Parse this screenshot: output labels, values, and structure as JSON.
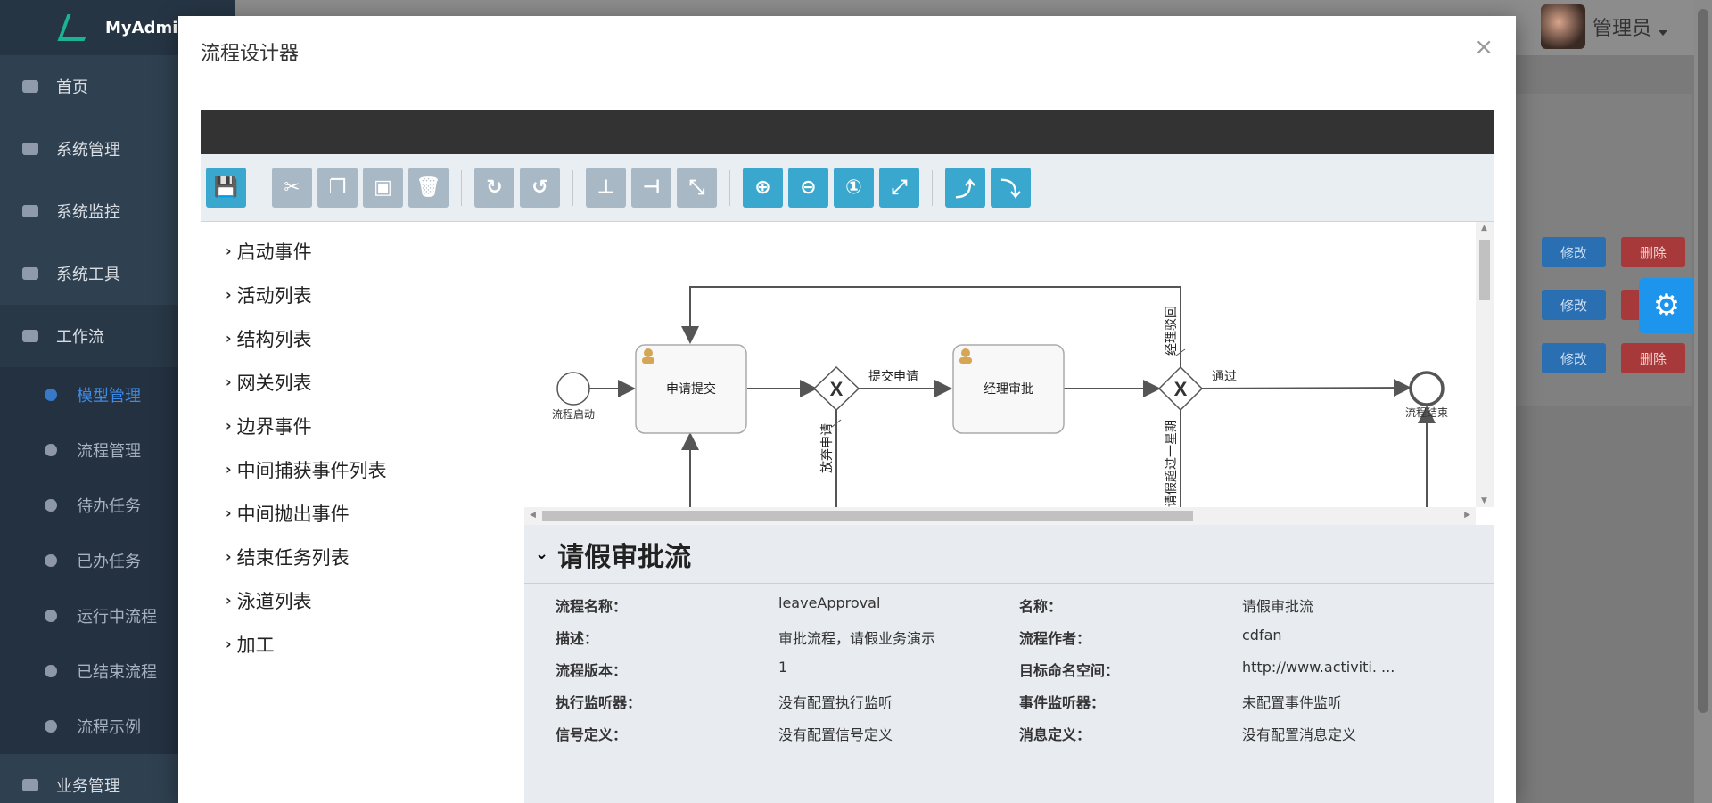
{
  "app": {
    "name": "MyAdmin"
  },
  "sidebar": {
    "items": [
      {
        "label": "首页"
      },
      {
        "label": "系统管理"
      },
      {
        "label": "系统监控"
      },
      {
        "label": "系统工具"
      },
      {
        "label": "工作流"
      }
    ],
    "sub_items": [
      {
        "label": "模型管理"
      },
      {
        "label": "流程管理"
      },
      {
        "label": "待办任务"
      },
      {
        "label": "已办任务"
      },
      {
        "label": "运行中流程"
      },
      {
        "label": "已结束流程"
      },
      {
        "label": "流程示例"
      }
    ],
    "last_item": {
      "label": "业务管理"
    }
  },
  "header": {
    "user": "管理员"
  },
  "background_table": {
    "edit_label": "修改",
    "delete_label": "删除"
  },
  "modal": {
    "title": "流程设计器",
    "close": "×"
  },
  "toolbar": {
    "groups": [
      [
        "save-icon"
      ],
      [
        "cut-icon",
        "copy-icon",
        "paste-icon",
        "delete-icon"
      ],
      [
        "redo-icon",
        "undo-icon"
      ],
      [
        "align-horizontal-icon",
        "align-vertical-icon",
        "resize-icon"
      ],
      [
        "zoom-in-icon",
        "zoom-out-icon",
        "zoom-reset-icon",
        "fit-icon"
      ],
      [
        "add-bendpoint-icon",
        "remove-bendpoint-icon"
      ]
    ]
  },
  "palette": {
    "items": [
      {
        "label": "启动事件"
      },
      {
        "label": "活动列表"
      },
      {
        "label": "结构列表"
      },
      {
        "label": "网关列表"
      },
      {
        "label": "边界事件"
      },
      {
        "label": "中间捕获事件列表"
      },
      {
        "label": "中间抛出事件"
      },
      {
        "label": "结束任务列表"
      },
      {
        "label": "泳道列表"
      },
      {
        "label": "加工"
      }
    ]
  },
  "diagram": {
    "start_label": "流程启动",
    "task1_label": "申请提交",
    "task2_label": "经理审批",
    "end_label": "流程结束",
    "flow_submit": "提交申请",
    "flow_pass": "通过",
    "flow_reject": "经理驳回",
    "flow_abandon": "放弃申请",
    "flow_overtime": "请假超过一星期"
  },
  "properties": {
    "title": "请假审批流",
    "rows": [
      {
        "k1": "流程名称：",
        "v1": "leaveApproval",
        "k2": "名称：",
        "v2": "请假审批流"
      },
      {
        "k1": "描述：",
        "v1": "审批流程，请假业务演示",
        "k2": "流程作者：",
        "v2": "cdfan"
      },
      {
        "k1": "流程版本：",
        "v1": "1",
        "k2": "目标命名空间：",
        "v2": "http://www.activiti. ..."
      },
      {
        "k1": "执行监听器：",
        "v1": "没有配置执行监听",
        "k2": "事件监听器：",
        "v2": "未配置事件监听"
      },
      {
        "k1": "信号定义：",
        "v1": "没有配置信号定义",
        "k2": "消息定义：",
        "v2": "没有配置消息定义"
      }
    ]
  }
}
